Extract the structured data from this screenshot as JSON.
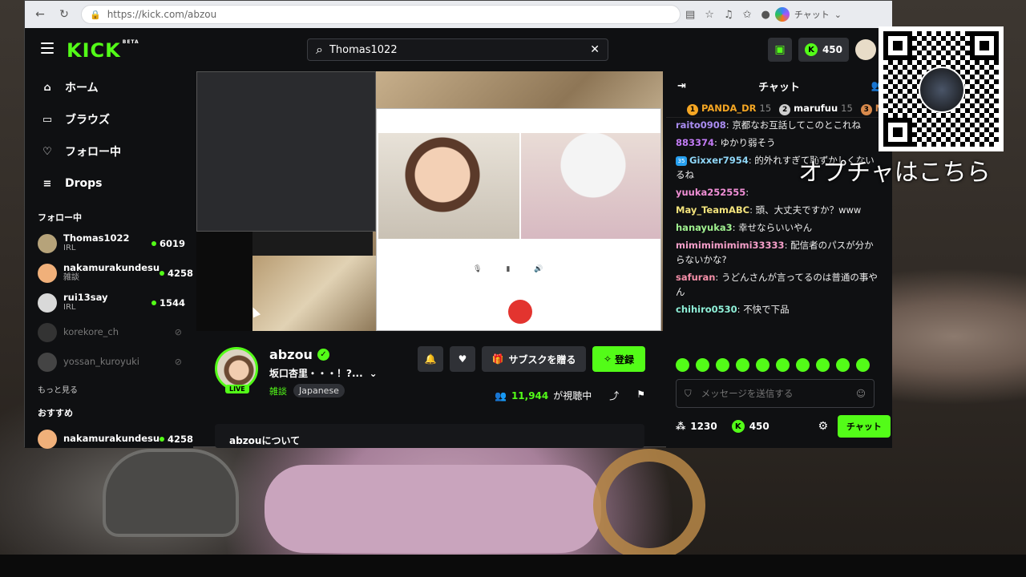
{
  "browser": {
    "url": "https://kick.com/abzou",
    "copilot_label": "チャット"
  },
  "kick": {
    "logo": "KICK",
    "logo_badge": "BETA",
    "search_value": "Thomas1022",
    "coins": "450"
  },
  "sidebar": {
    "nav": [
      {
        "label": "ホーム",
        "icon": "home-icon"
      },
      {
        "label": "ブラウズ",
        "icon": "browse-icon"
      },
      {
        "label": "フォロー中",
        "icon": "heart-icon"
      },
      {
        "label": "Drops",
        "icon": "drops-icon"
      }
    ],
    "following_title": "フォロー中",
    "following": [
      {
        "name": "Thomas1022",
        "category": "IRL",
        "viewers": "6019"
      },
      {
        "name": "nakamurakundesu",
        "category": "雑談",
        "viewers": "4258"
      },
      {
        "name": "rui13say",
        "category": "IRL",
        "viewers": "1544"
      },
      {
        "name": "korekore_ch"
      },
      {
        "name": "yossan_kuroyuki"
      }
    ],
    "more": "もっと見る",
    "recommended_title": "おすすめ",
    "recommended": [
      {
        "name": "nakamurakundesu",
        "viewers": "4258"
      }
    ]
  },
  "stream": {
    "name": "abzou",
    "title": "坂口杏里・・・！?...",
    "category": "雑談",
    "language": "Japanese",
    "live": "LIVE",
    "gift_sub": "サブスクを贈る",
    "subscribe": "登録",
    "viewers": "11,944",
    "viewers_suffix": "が視聴中",
    "about": "abzouについて"
  },
  "chat": {
    "title": "チャット",
    "leaderboard": [
      {
        "rank": "1",
        "name": "PANDA_DR",
        "count": "15"
      },
      {
        "rank": "2",
        "name": "marufuu",
        "count": "15"
      },
      {
        "rank": "3",
        "name": "M"
      }
    ],
    "messages": [
      {
        "user": "raito0908",
        "color": "#a98cf0",
        "text": "京都なお互話してこのとこれね"
      },
      {
        "user": "883374",
        "color": "#c27bf5",
        "text": "ゆかり弱そう"
      },
      {
        "user": "Gixxer7954",
        "color": "#8fd6f7",
        "text": "的外れすぎて恥ずかしくないるね",
        "badge": "35"
      },
      {
        "user": "yuuka252555",
        "color": "#f08fd5",
        "text": ""
      },
      {
        "user": "May_TeamABC",
        "color": "#f3e37c",
        "text": "頭、大丈夫ですか？www"
      },
      {
        "user": "hanayuka3",
        "color": "#9ff08f",
        "text": "幸せならいいやん"
      },
      {
        "user": "mimimimimimi33333",
        "color": "#f59fc9",
        "text": "配信者のパスが分からないかな?"
      },
      {
        "user": "safuran",
        "color": "#f58fa8",
        "text": "うどんさんが言ってるのは普通の事やん"
      },
      {
        "user": "chihiro0530",
        "color": "#8ff0d8",
        "text": "不快で下品"
      }
    ],
    "placeholder": "メッセージを送信する",
    "points": "1230",
    "coins": "450",
    "send": "チャット"
  },
  "overlay": {
    "text": "オプチャはこちら"
  },
  "colors": {
    "accent": "#53fc18",
    "background": "#0f1012"
  }
}
